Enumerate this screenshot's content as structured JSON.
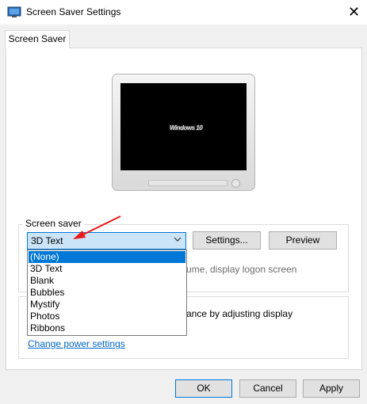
{
  "window": {
    "title": "Screen Saver Settings",
    "close_glyph": "✕",
    "icon": "screen-saver-app-icon"
  },
  "tab": {
    "label": "Screen Saver"
  },
  "preview": {
    "screen_text": "Windows 10"
  },
  "screen_saver_group": {
    "label": "Screen saver",
    "selected": "3D Text",
    "settings_label": "Settings...",
    "preview_label": "Preview",
    "resume_partial": "ume, display logon screen",
    "options": [
      "(None)",
      "3D Text",
      "Blank",
      "Bubbles",
      "Mystify",
      "Photos",
      "Ribbons"
    ],
    "highlighted_option": "(None)"
  },
  "power_group": {
    "partial_text": "ance by adjusting display",
    "link_label": "Change power settings"
  },
  "footer": {
    "ok_label": "OK",
    "cancel_label": "Cancel",
    "apply_label": "Apply"
  },
  "colors": {
    "accent": "#0078d7",
    "arrow": "#e8191a",
    "link": "#0066cc"
  }
}
